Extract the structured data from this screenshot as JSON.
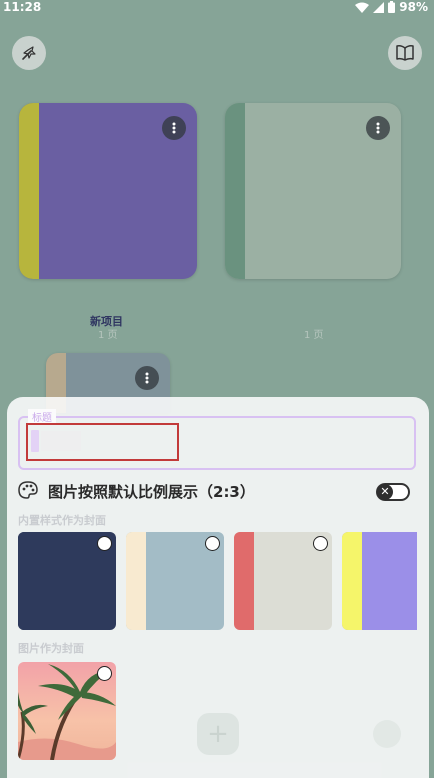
{
  "status_bar": {
    "time": "11:28",
    "battery": "98%"
  },
  "top_bar": {
    "left_icon": "magic-wand-icon",
    "right_icon": "book-open-icon"
  },
  "notebooks": [
    {
      "title": "",
      "pages": "",
      "spine_color": "#b7b53d",
      "body_color": "#6a5fa2"
    },
    {
      "title": "",
      "pages": "",
      "spine_color": "#6a927f",
      "body_color": "#9bb0a3"
    },
    {
      "title": "",
      "pages": "",
      "spine_color": "#b7a98e",
      "body_color": "#7f929a"
    }
  ],
  "notebook_labels": {
    "first_title": "新项目",
    "first_pages": "1 页",
    "second_pages": "1 页"
  },
  "sheet": {
    "title_field": {
      "label": "标题",
      "value": ""
    },
    "aspect_toggle": {
      "label": "图片按照默认比例展示（2:3）",
      "state": "off"
    },
    "builtin_section": "内置样式作为封面",
    "image_section": "图片作为封面",
    "builtin_covers": [
      {
        "spine": "#2e3a5c",
        "body": "#2e3a5c"
      },
      {
        "spine": "#f8ead0",
        "body": "#a3bcc6"
      },
      {
        "spine": "#e06b6b",
        "body": "#dcddd5"
      },
      {
        "spine": "#f5f56a",
        "body": "#9b8fe8"
      }
    ]
  },
  "colors": {
    "background": "#86a497",
    "accent": "#d8c1f2",
    "highlight_box": "#c23a3a"
  }
}
